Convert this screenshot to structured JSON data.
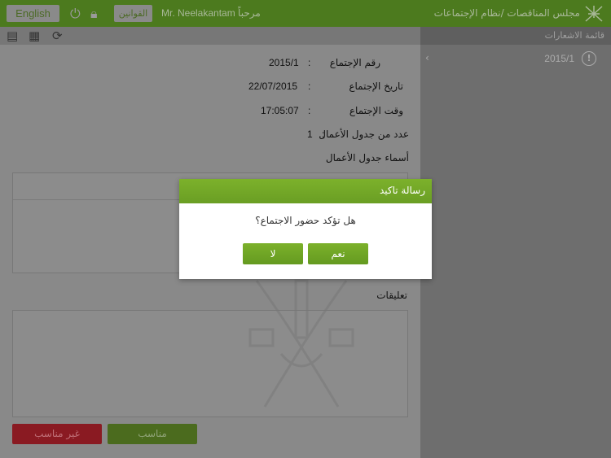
{
  "header": {
    "app_title": "مجلس المناقصات /نظام الإجتماعات",
    "welcome": "مرحباً Mr. Neelakantam",
    "laws_button": "القوانين",
    "language_button": "English"
  },
  "toolbar": {
    "icons": [
      "document-icon",
      "calendar-icon",
      "refresh-icon"
    ]
  },
  "sidebar": {
    "title": "قائمة الاشعارات",
    "items": [
      {
        "label": "2015/1",
        "icon": "alert-icon"
      }
    ]
  },
  "meeting": {
    "number_label": "رقم الإجتماع",
    "number": "2015/1",
    "date_label": "تاريخ الإجتماع",
    "date": "22/07/2015",
    "time_label": "وقت الإجتماع",
    "time": "17:05:07",
    "agenda_count_label": "عدد من جدول الأعمال",
    "agenda_count": "1",
    "agenda_names_label": "أسماء جدول الأعمال",
    "colon": ":"
  },
  "comments_label": "تعليقات",
  "buttons": {
    "suitable": "مناسب",
    "unsuitable": "غير مناسب"
  },
  "dialog": {
    "title": "رسالة تاكيد",
    "message": "هل تؤكد حضور الاجتماع؟",
    "yes": "نعم",
    "no": "لا"
  },
  "colors": {
    "header": "#4c7a1e",
    "dialog_accent": "#72a827",
    "danger": "#8a1a22"
  }
}
